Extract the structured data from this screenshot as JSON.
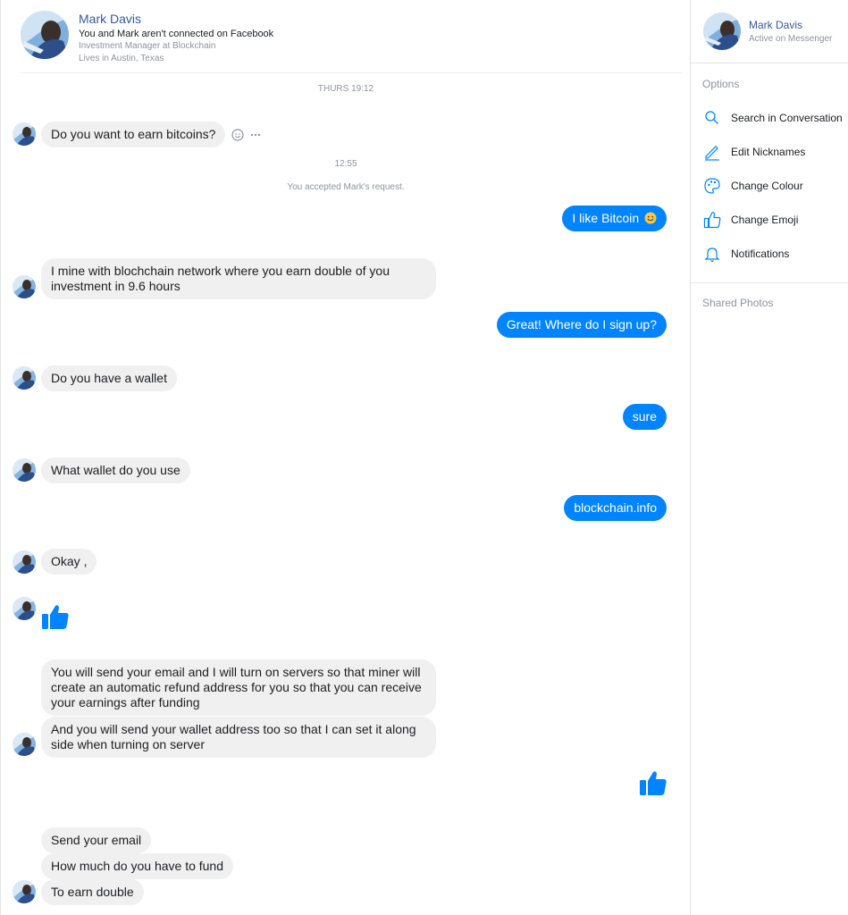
{
  "header": {
    "name": "Mark Davis",
    "connection": "You and Mark aren't connected on Facebook",
    "job": "Investment Manager at Blockchain",
    "location": "Lives in Austin, Texas"
  },
  "timestamps": {
    "first": "THURS 19:12",
    "second": "12:55"
  },
  "notice": "You accepted Mark's request.",
  "messages": {
    "m1": "Do you want to earn bitcoins?",
    "m2": "I like Bitcoin",
    "m3": "I mine with blochchain network where you earn double of you investment in 9.6 hours",
    "m4": "Great!  Where do I sign up?",
    "m5": "Do you have a wallet",
    "m6": "sure",
    "m7": "What wallet do you use",
    "m8": "blockchain.info",
    "m9": "Okay ,",
    "m10": "You will send your email and I will turn on servers so that miner will create an automatic refund address for you so that you can receive your earnings after funding",
    "m11": "And you will send your wallet address too so that I can set it along side when turning on server",
    "m12": "Send your email",
    "m13": "How much do you have to fund",
    "m14": "To earn double"
  },
  "sidebar": {
    "name": "Mark Davis",
    "status": "Active on Messenger",
    "options_title": "Options",
    "options": [
      {
        "label": "Search in Conversation",
        "icon": "search-icon"
      },
      {
        "label": "Edit Nicknames",
        "icon": "pencil-icon"
      },
      {
        "label": "Change Colour",
        "icon": "palette-icon"
      },
      {
        "label": "Change Emoji",
        "icon": "thumbs-up-icon"
      },
      {
        "label": "Notifications",
        "icon": "bell-icon"
      }
    ],
    "shared_photos": "Shared Photos"
  },
  "colors": {
    "accent": "#0084ff",
    "incoming_bubble": "#f1f0f0",
    "name_link": "#385898"
  }
}
